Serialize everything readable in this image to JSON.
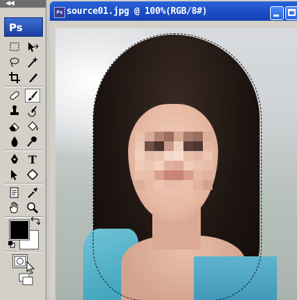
{
  "toolbar": {
    "grip_label": "◀◀",
    "logo_text": "Ps",
    "tools": [
      {
        "name": "rectangular-marquee-tool"
      },
      {
        "name": "move-tool"
      },
      {
        "name": "lasso-tool"
      },
      {
        "name": "magic-wand-tool"
      },
      {
        "name": "crop-tool"
      },
      {
        "name": "slice-tool"
      },
      {
        "name": "healing-brush-tool"
      },
      {
        "name": "brush-tool",
        "active": true
      },
      {
        "name": "clone-stamp-tool"
      },
      {
        "name": "history-brush-tool"
      },
      {
        "name": "eraser-tool"
      },
      {
        "name": "paint-bucket-tool"
      },
      {
        "name": "blur-tool"
      },
      {
        "name": "dodge-tool"
      },
      {
        "name": "pen-tool"
      },
      {
        "name": "type-tool"
      },
      {
        "name": "path-selection-tool"
      },
      {
        "name": "custom-shape-tool"
      },
      {
        "name": "notes-tool"
      },
      {
        "name": "eyedropper-tool"
      },
      {
        "name": "hand-tool"
      },
      {
        "name": "zoom-tool"
      }
    ],
    "type_tool_glyph": "T",
    "foreground_color": "#000000",
    "background_color": "#ffffff"
  },
  "document": {
    "title": "source01.jpg @ 100%(RGB/8#)",
    "icon_text": "Ps",
    "titlebar_color": "#1b4fc7"
  }
}
